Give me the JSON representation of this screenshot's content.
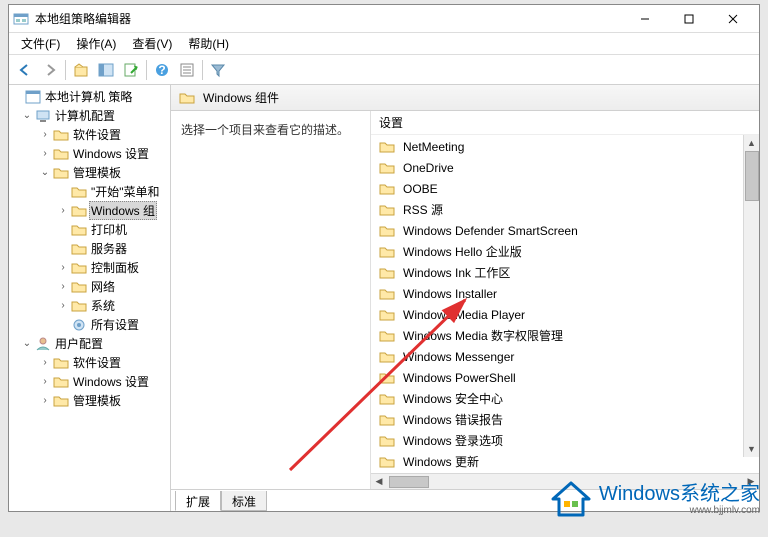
{
  "title": "本地组策略编辑器",
  "menu": {
    "file": "文件(F)",
    "action": "操作(A)",
    "view": "查看(V)",
    "help": "帮助(H)"
  },
  "tree": {
    "root": "本地计算机 策略",
    "computer_config": "计算机配置",
    "software_settings": "软件设置",
    "windows_settings": "Windows 设置",
    "admin_templates": "管理模板",
    "start_menu": "\"开始\"菜单和",
    "windows_components": "Windows 组",
    "printers": "打印机",
    "servers": "服务器",
    "control_panel": "控制面板",
    "network": "网络",
    "system": "系统",
    "all_settings": "所有设置",
    "user_config": "用户配置",
    "u_software_settings": "软件设置",
    "u_windows_settings": "Windows 设置",
    "u_admin_templates": "管理模板"
  },
  "header_title": "Windows 组件",
  "desc": "选择一个项目来查看它的描述。",
  "col_setting": "设置",
  "items": [
    "NetMeeting",
    "OneDrive",
    "OOBE",
    "RSS 源",
    "Windows Defender SmartScreen",
    "Windows Hello 企业版",
    "Windows Ink 工作区",
    "Windows Installer",
    "Windows Media Player",
    "Windows Media 数字权限管理",
    "Windows Messenger",
    "Windows PowerShell",
    "Windows 安全中心",
    "Windows 错误报告",
    "Windows 登录选项",
    "Windows 更新"
  ],
  "tabs": {
    "extended": "扩展",
    "standard": "标准"
  },
  "watermark": {
    "main": "Windows系统之家",
    "sub": "www.bjjmlv.com"
  }
}
